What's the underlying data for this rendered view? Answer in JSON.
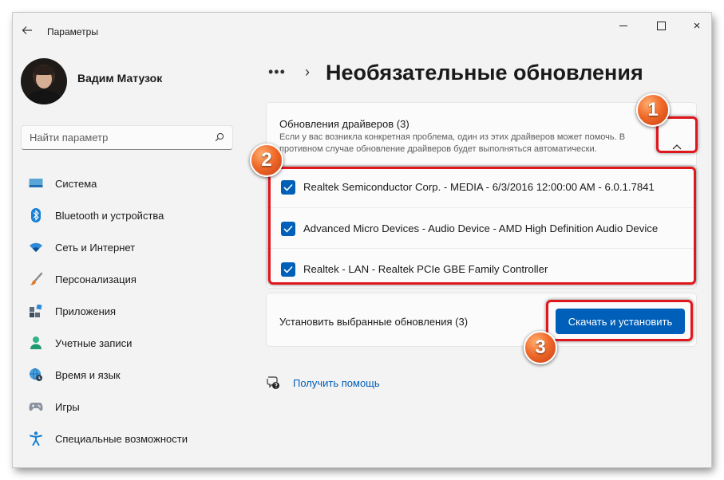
{
  "window": {
    "title": "Параметры",
    "buttons": {
      "minimize": "minimize",
      "maximize": "maximize",
      "close": "×"
    }
  },
  "user": {
    "name": "Вадим Матузок"
  },
  "search": {
    "placeholder": "Найти параметр"
  },
  "sidebar": {
    "items": [
      {
        "label": "Система",
        "icon": "system-icon"
      },
      {
        "label": "Bluetooth и устройства",
        "icon": "bluetooth-icon"
      },
      {
        "label": "Сеть и Интернет",
        "icon": "wifi-icon"
      },
      {
        "label": "Персонализация",
        "icon": "brush-icon"
      },
      {
        "label": "Приложения",
        "icon": "apps-icon"
      },
      {
        "label": "Учетные записи",
        "icon": "accounts-icon"
      },
      {
        "label": "Время и язык",
        "icon": "globe-clock-icon"
      },
      {
        "label": "Игры",
        "icon": "gamepad-icon"
      },
      {
        "label": "Специальные возможности",
        "icon": "accessibility-icon"
      }
    ]
  },
  "breadcrumb": {
    "ellipsis": "•••",
    "separator": "›"
  },
  "page": {
    "title": "Необязательные обновления"
  },
  "drivers": {
    "title": "Обновления драйверов (3)",
    "description": "Если у вас возникла конкретная проблема, один из этих драйверов может помочь. В противном случае обновление драйверов будет выполняться автоматически.",
    "expanded": true,
    "items": [
      {
        "label": "Realtek Semiconductor Corp. - MEDIA - 6/3/2016 12:00:00 AM - 6.0.1.7841",
        "checked": true
      },
      {
        "label": "Advanced Micro Devices - Audio Device - AMD High Definition Audio Device",
        "checked": true
      },
      {
        "label": "Realtek - LAN - Realtek PCIe GBE Family Controller",
        "checked": true
      }
    ]
  },
  "install": {
    "label": "Установить выбранные обновления (3)",
    "button": "Скачать и установить"
  },
  "help": {
    "label": "Получить помощь"
  },
  "annotations": {
    "badge1": "1",
    "badge2": "2",
    "badge3": "3",
    "color": "#e0161d"
  },
  "colors": {
    "accent": "#005fb8",
    "window_bg": "#f3f3f3",
    "card_bg": "#fbfbfb"
  }
}
